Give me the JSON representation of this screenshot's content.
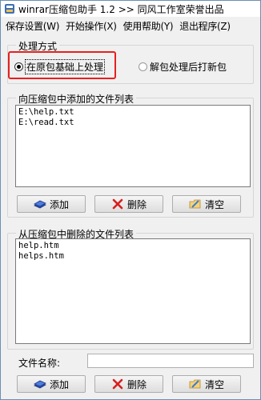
{
  "window": {
    "title": "winrar压缩包助手 1.2  >> 同风工作室荣誉出品"
  },
  "menu": [
    "保存设置(W)",
    "开始操作(X)",
    "使用帮助(Y)",
    "退出程序(Z)"
  ],
  "mode_group": {
    "title": "处理方式",
    "option_inplace": "在原包基础上处理",
    "option_repack": "解包处理后打新包",
    "selected": "option_inplace"
  },
  "add_group": {
    "title": "向压缩包中添加的文件列表",
    "files": [
      "E:\\help.txt",
      "E:\\read.txt"
    ],
    "buttons": {
      "add": "添加",
      "delete": "删除",
      "clear": "清空"
    }
  },
  "delete_group": {
    "title": "从压缩包中删除的文件列表",
    "files": [
      "help.htm",
      "helps.htm"
    ]
  },
  "filename": {
    "label": "文件名称:",
    "value": ""
  },
  "bottom_buttons": {
    "add": "添加",
    "delete": "删除",
    "clear": "清空"
  },
  "colors": {
    "highlight": "#e6201f",
    "window_border": "#6b8fb5"
  }
}
